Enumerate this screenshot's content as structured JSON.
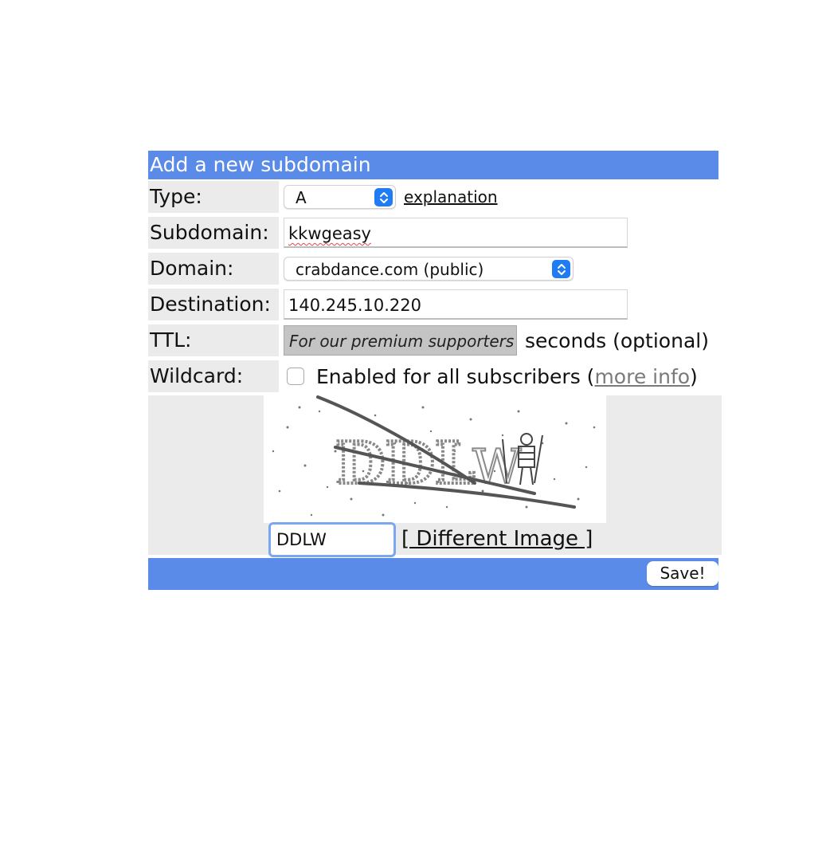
{
  "form": {
    "title": "Add a new subdomain",
    "type": {
      "label": "Type:",
      "value": "A",
      "explanation_link": "explanation"
    },
    "subdomain": {
      "label": "Subdomain:",
      "value": "kkwgeasy"
    },
    "domain": {
      "label": "Domain:",
      "value": "crabdance.com (public)"
    },
    "destination": {
      "label": "Destination:",
      "value": "140.245.10.220"
    },
    "ttl": {
      "label": "TTL:",
      "placeholder": "For our premium supporters",
      "suffix": "seconds (optional)"
    },
    "wildcard": {
      "label": "Wildcard:",
      "checked": false,
      "text_before": "Enabled for all subscribers (",
      "more_info_link": "more info",
      "text_after": ")"
    },
    "captcha": {
      "value": "DDLW",
      "different_image": "[ Different Image ]"
    },
    "save_label": "Save!"
  },
  "colors": {
    "header_blue": "#5b8be8",
    "label_bg": "#ebebeb",
    "select_accent": "#1f7cf5",
    "captcha_focus": "#7aa7ef",
    "muted_link": "#7a7a7a"
  },
  "icons": {
    "select_arrows": "up-down-chevron-icon",
    "checkbox": "checkbox-unchecked-icon"
  }
}
